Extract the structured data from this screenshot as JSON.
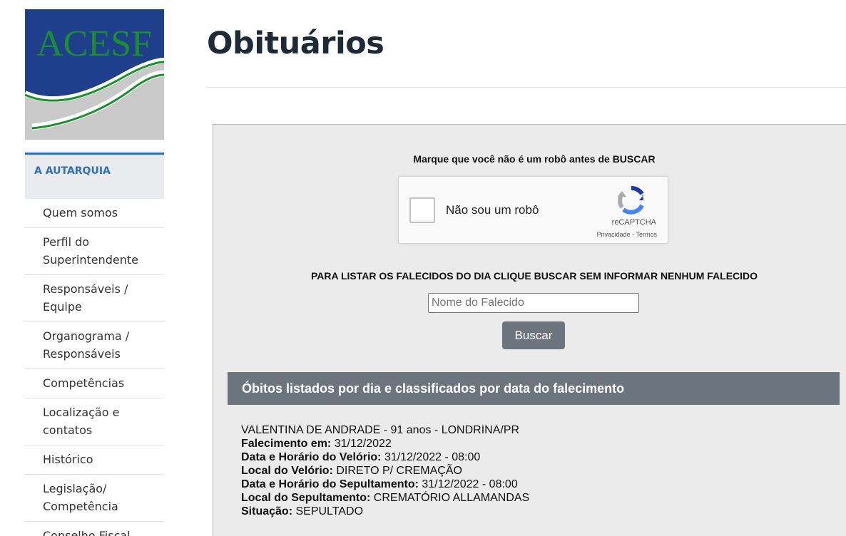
{
  "sidebar": {
    "logo_text": "ACESF",
    "section_title": "A AUTARQUIA",
    "items": [
      {
        "label": "Quem somos"
      },
      {
        "label": "Perfil do Superintendente"
      },
      {
        "label": "Responsáveis / Equipe"
      },
      {
        "label": "Organograma / Responsáveis"
      },
      {
        "label": "Competências"
      },
      {
        "label": "Localização e contatos"
      },
      {
        "label": "Histórico"
      },
      {
        "label": "Legislação/ Competência"
      },
      {
        "label": "Conselho Fiscal"
      }
    ]
  },
  "page": {
    "title": "Obituários"
  },
  "search": {
    "captcha_instruction": "Marque que você não é um robô antes de BUSCAR",
    "captcha_label": "Não sou um robô",
    "captcha_brand": "reCAPTCHA",
    "captcha_privacy": "Privacidade",
    "captcha_separator": "-",
    "captcha_terms": "Termos",
    "list_instruction": "PARA LISTAR OS FALECIDOS DO DIA CLIQUE BUSCAR SEM INFORMAR NENHUM FALECIDO",
    "placeholder": "Nome do Falecido",
    "value": "",
    "button_label": "Buscar"
  },
  "results": {
    "header": "Óbitos listados por dia e classificados por data do falecimento",
    "entries": [
      {
        "name_line": "VALENTINA DE ANDRADE - 91 anos - LONDRINA/PR",
        "death_label": "Falecimento em:",
        "death_value": "31/12/2022",
        "wake_time_label": "Data e Horário do Velório:",
        "wake_time_value": "31/12/2022 - 08:00",
        "wake_place_label": "Local do Velório:",
        "wake_place_value": "DIRETO P/ CREMAÇÃO",
        "burial_time_label": "Data e Horário do Sepultamento:",
        "burial_time_value": "31/12/2022 - 08:00",
        "burial_place_label": "Local do Sepultamento:",
        "burial_place_value": "CREMATÓRIO ALLAMANDAS",
        "status_label": "Situação:",
        "status_value": "SEPULTADO"
      }
    ]
  },
  "colors": {
    "accent_blue": "#2f6fc0",
    "button_gray": "#6c757d",
    "logo_navy": "#1f3f8c",
    "logo_green": "#1a8f2e"
  }
}
